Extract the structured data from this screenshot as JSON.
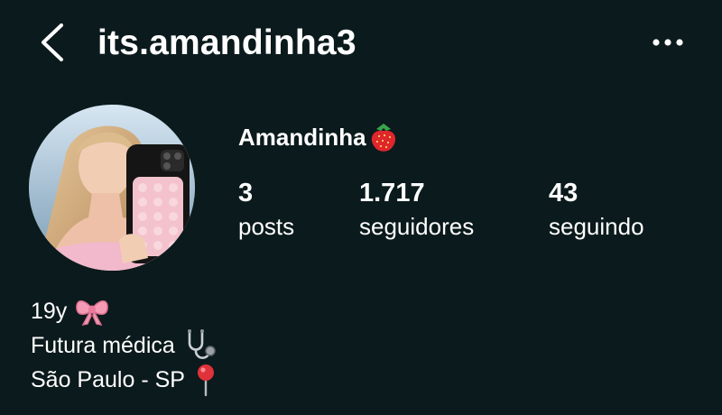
{
  "header": {
    "username": "its.amandinha3",
    "back_icon": "chevron-left-icon",
    "more_icon": "more-horizontal-icon"
  },
  "profile": {
    "display_name": "Amandinha",
    "name_emoji": "strawberry-icon",
    "avatar_icon": "profile-photo"
  },
  "stats": {
    "posts": {
      "value": "3",
      "label": "posts"
    },
    "followers": {
      "value": "1.717",
      "label": "seguidores"
    },
    "following": {
      "value": "43",
      "label": "seguindo"
    }
  },
  "bio": {
    "line1": {
      "text": "19y",
      "emoji": "pink-bow-icon"
    },
    "line2": {
      "text": "Futura médica",
      "emoji": "stethoscope-icon"
    },
    "line3": {
      "text": "São Paulo - SP",
      "emoji": "round-pushpin-icon"
    }
  },
  "colors": {
    "background": "#0b1a1c",
    "text": "#ffffff"
  }
}
